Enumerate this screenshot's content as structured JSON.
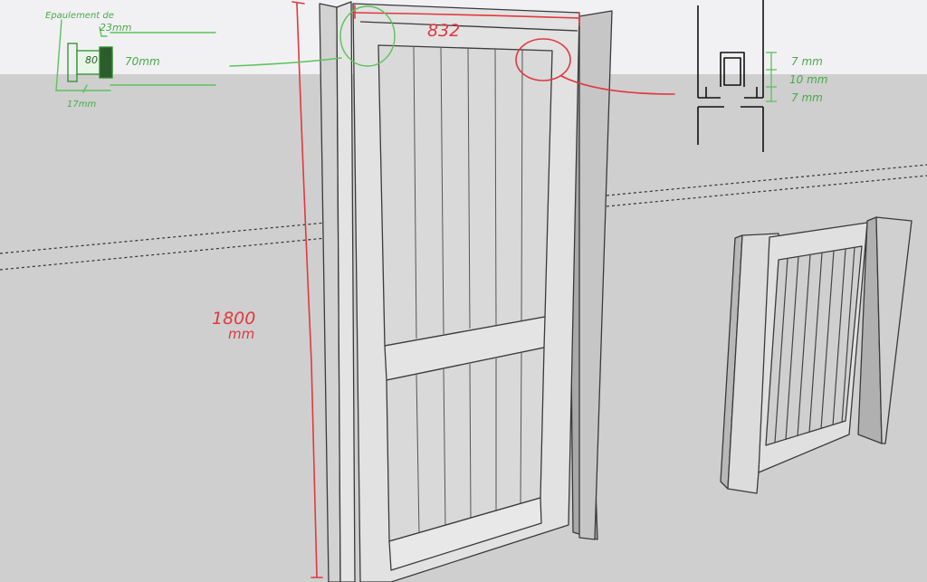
{
  "annotations": {
    "width_label": "832",
    "height_value": "1800",
    "height_unit": "mm",
    "green_note_title": "Epaulement de",
    "green_23": "23mm",
    "green_80": "80",
    "green_70": "70mm",
    "green_17": "17mm",
    "dim_top": "7 mm",
    "dim_mid": "10 mm",
    "dim_bot": "7 mm"
  },
  "colors": {
    "sky": "#f1f1f3",
    "ground": "#cfcfcf",
    "door_face": "#e2e2e2",
    "door_shadow": "#b9b9b9",
    "outline": "#3a3a3a",
    "red_markup": "#e0393e",
    "green_markup": "#5cc25c",
    "black_sketch": "#111111"
  },
  "icons": {
    "door_model": "door-3d-model",
    "gate_model": "small-gate-3d-model",
    "profile_sketch": "tenon-profile-sketch"
  }
}
